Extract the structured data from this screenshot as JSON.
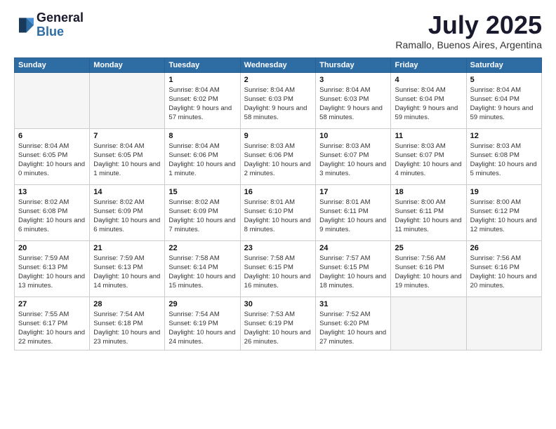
{
  "logo": {
    "line1": "General",
    "line2": "Blue"
  },
  "title": "July 2025",
  "subtitle": "Ramallo, Buenos Aires, Argentina",
  "days_of_week": [
    "Sunday",
    "Monday",
    "Tuesday",
    "Wednesday",
    "Thursday",
    "Friday",
    "Saturday"
  ],
  "weeks": [
    [
      {
        "day": "",
        "info": ""
      },
      {
        "day": "",
        "info": ""
      },
      {
        "day": "1",
        "info": "Sunrise: 8:04 AM\nSunset: 6:02 PM\nDaylight: 9 hours\nand 57 minutes."
      },
      {
        "day": "2",
        "info": "Sunrise: 8:04 AM\nSunset: 6:03 PM\nDaylight: 9 hours\nand 58 minutes."
      },
      {
        "day": "3",
        "info": "Sunrise: 8:04 AM\nSunset: 6:03 PM\nDaylight: 9 hours\nand 58 minutes."
      },
      {
        "day": "4",
        "info": "Sunrise: 8:04 AM\nSunset: 6:04 PM\nDaylight: 9 hours\nand 59 minutes."
      },
      {
        "day": "5",
        "info": "Sunrise: 8:04 AM\nSunset: 6:04 PM\nDaylight: 9 hours\nand 59 minutes."
      }
    ],
    [
      {
        "day": "6",
        "info": "Sunrise: 8:04 AM\nSunset: 6:05 PM\nDaylight: 10 hours\nand 0 minutes."
      },
      {
        "day": "7",
        "info": "Sunrise: 8:04 AM\nSunset: 6:05 PM\nDaylight: 10 hours\nand 1 minute."
      },
      {
        "day": "8",
        "info": "Sunrise: 8:04 AM\nSunset: 6:06 PM\nDaylight: 10 hours\nand 1 minute."
      },
      {
        "day": "9",
        "info": "Sunrise: 8:03 AM\nSunset: 6:06 PM\nDaylight: 10 hours\nand 2 minutes."
      },
      {
        "day": "10",
        "info": "Sunrise: 8:03 AM\nSunset: 6:07 PM\nDaylight: 10 hours\nand 3 minutes."
      },
      {
        "day": "11",
        "info": "Sunrise: 8:03 AM\nSunset: 6:07 PM\nDaylight: 10 hours\nand 4 minutes."
      },
      {
        "day": "12",
        "info": "Sunrise: 8:03 AM\nSunset: 6:08 PM\nDaylight: 10 hours\nand 5 minutes."
      }
    ],
    [
      {
        "day": "13",
        "info": "Sunrise: 8:02 AM\nSunset: 6:08 PM\nDaylight: 10 hours\nand 6 minutes."
      },
      {
        "day": "14",
        "info": "Sunrise: 8:02 AM\nSunset: 6:09 PM\nDaylight: 10 hours\nand 6 minutes."
      },
      {
        "day": "15",
        "info": "Sunrise: 8:02 AM\nSunset: 6:09 PM\nDaylight: 10 hours\nand 7 minutes."
      },
      {
        "day": "16",
        "info": "Sunrise: 8:01 AM\nSunset: 6:10 PM\nDaylight: 10 hours\nand 8 minutes."
      },
      {
        "day": "17",
        "info": "Sunrise: 8:01 AM\nSunset: 6:11 PM\nDaylight: 10 hours\nand 9 minutes."
      },
      {
        "day": "18",
        "info": "Sunrise: 8:00 AM\nSunset: 6:11 PM\nDaylight: 10 hours\nand 11 minutes."
      },
      {
        "day": "19",
        "info": "Sunrise: 8:00 AM\nSunset: 6:12 PM\nDaylight: 10 hours\nand 12 minutes."
      }
    ],
    [
      {
        "day": "20",
        "info": "Sunrise: 7:59 AM\nSunset: 6:13 PM\nDaylight: 10 hours\nand 13 minutes."
      },
      {
        "day": "21",
        "info": "Sunrise: 7:59 AM\nSunset: 6:13 PM\nDaylight: 10 hours\nand 14 minutes."
      },
      {
        "day": "22",
        "info": "Sunrise: 7:58 AM\nSunset: 6:14 PM\nDaylight: 10 hours\nand 15 minutes."
      },
      {
        "day": "23",
        "info": "Sunrise: 7:58 AM\nSunset: 6:15 PM\nDaylight: 10 hours\nand 16 minutes."
      },
      {
        "day": "24",
        "info": "Sunrise: 7:57 AM\nSunset: 6:15 PM\nDaylight: 10 hours\nand 18 minutes."
      },
      {
        "day": "25",
        "info": "Sunrise: 7:56 AM\nSunset: 6:16 PM\nDaylight: 10 hours\nand 19 minutes."
      },
      {
        "day": "26",
        "info": "Sunrise: 7:56 AM\nSunset: 6:16 PM\nDaylight: 10 hours\nand 20 minutes."
      }
    ],
    [
      {
        "day": "27",
        "info": "Sunrise: 7:55 AM\nSunset: 6:17 PM\nDaylight: 10 hours\nand 22 minutes."
      },
      {
        "day": "28",
        "info": "Sunrise: 7:54 AM\nSunset: 6:18 PM\nDaylight: 10 hours\nand 23 minutes."
      },
      {
        "day": "29",
        "info": "Sunrise: 7:54 AM\nSunset: 6:19 PM\nDaylight: 10 hours\nand 24 minutes."
      },
      {
        "day": "30",
        "info": "Sunrise: 7:53 AM\nSunset: 6:19 PM\nDaylight: 10 hours\nand 26 minutes."
      },
      {
        "day": "31",
        "info": "Sunrise: 7:52 AM\nSunset: 6:20 PM\nDaylight: 10 hours\nand 27 minutes."
      },
      {
        "day": "",
        "info": ""
      },
      {
        "day": "",
        "info": ""
      }
    ]
  ]
}
